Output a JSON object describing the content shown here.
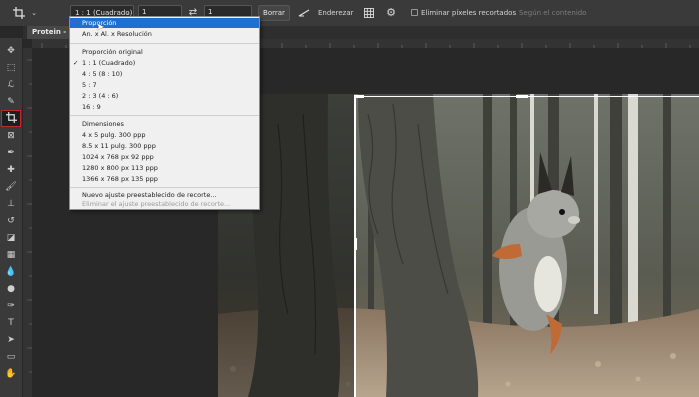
{
  "options_bar": {
    "preset_value": "1 : 1 (Cuadrado)",
    "width_value": "1",
    "height_value": "1",
    "clear_label": "Borrar",
    "straighten_label": "Enderezar",
    "delete_cropped_label": "Eliminar píxeles recortados",
    "content_aware_label": "Según el contenido"
  },
  "document": {
    "tab_title": "Protein - 13"
  },
  "preset_menu": {
    "items": [
      {
        "label": "Proporción",
        "highlighted": true
      },
      {
        "label": "An. x Al. x Resolución"
      },
      {
        "label": "Proporción original"
      },
      {
        "label": "1 : 1 (Cuadrado)",
        "checked": true
      },
      {
        "label": "4 : 5 (8 : 10)"
      },
      {
        "label": "5 : 7"
      },
      {
        "label": "2 : 3 (4 : 6)"
      },
      {
        "label": "16 : 9"
      },
      {
        "label": "Dimensiones"
      },
      {
        "label": "4 x 5 pulg.  300 ppp"
      },
      {
        "label": "8.5 x 11 pulg.  300 ppp"
      },
      {
        "label": "1024 x 768 px  92 ppp"
      },
      {
        "label": "1280 x 800 px  113 ppp"
      },
      {
        "label": "1366 x 768 px  135 ppp"
      },
      {
        "label": "Nuevo ajuste preestablecido de recorte..."
      },
      {
        "label": "Eliminar el ajuste preestablecido de recorte...",
        "disabled": true
      }
    ],
    "check_mark": "✓"
  },
  "tools": [
    "move-tool",
    "marquee-tool",
    "lasso-tool",
    "quick-select-tool",
    "crop-tool",
    "frame-tool",
    "eyedropper-tool",
    "spot-heal-tool",
    "brush-tool",
    "stamp-tool",
    "history-brush-tool",
    "eraser-tool",
    "gradient-tool",
    "blur-tool",
    "dodge-tool",
    "pen-tool",
    "type-tool",
    "path-select-tool",
    "rectangle-tool",
    "hand-tool"
  ],
  "colors": {
    "accent_highlight": "#1f6fd0",
    "active_tool_outline": "#c4282d"
  }
}
